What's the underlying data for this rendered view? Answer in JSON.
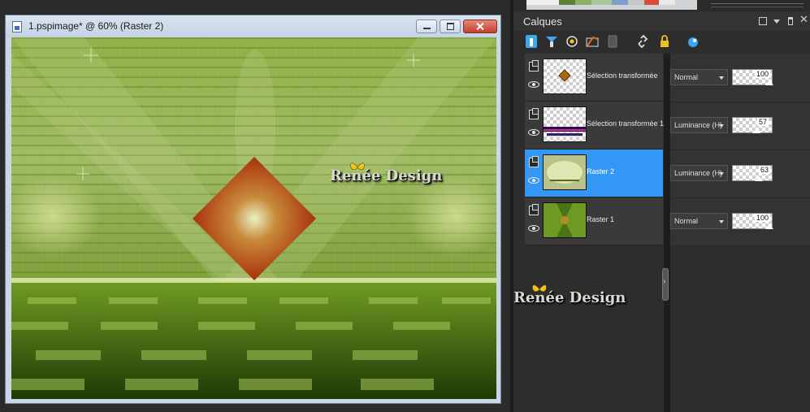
{
  "image_window": {
    "title": "1.pspimage* @  60% (Raster 2)",
    "watermark": "Renée Design"
  },
  "layers_panel": {
    "title": "Calques",
    "watermark": "Renée Design",
    "toolbar_icons": [
      "new-raster-layer-icon",
      "new-vector-layer-icon",
      "new-adjustment-layer-icon",
      "new-mask-layer-icon",
      "delete-layer-icon",
      "link-icon",
      "lock-icon",
      "fx-icon"
    ],
    "layers": [
      {
        "name": "Sélection transformée",
        "blend_mode": "Normal",
        "opacity": "100",
        "selected": false
      },
      {
        "name": "Sélection transformée 1",
        "blend_mode": "Luminance (H)",
        "opacity": "57",
        "selected": false
      },
      {
        "name": "Raster 2",
        "blend_mode": "Luminance (H)",
        "opacity": "63",
        "selected": true
      },
      {
        "name": "Raster 1",
        "blend_mode": "Normal",
        "opacity": "100",
        "selected": false
      }
    ]
  },
  "colors": {
    "selected_layer": "#3398f5",
    "canvas_green": "#6d8d2a",
    "diamond": "#b0390f"
  }
}
